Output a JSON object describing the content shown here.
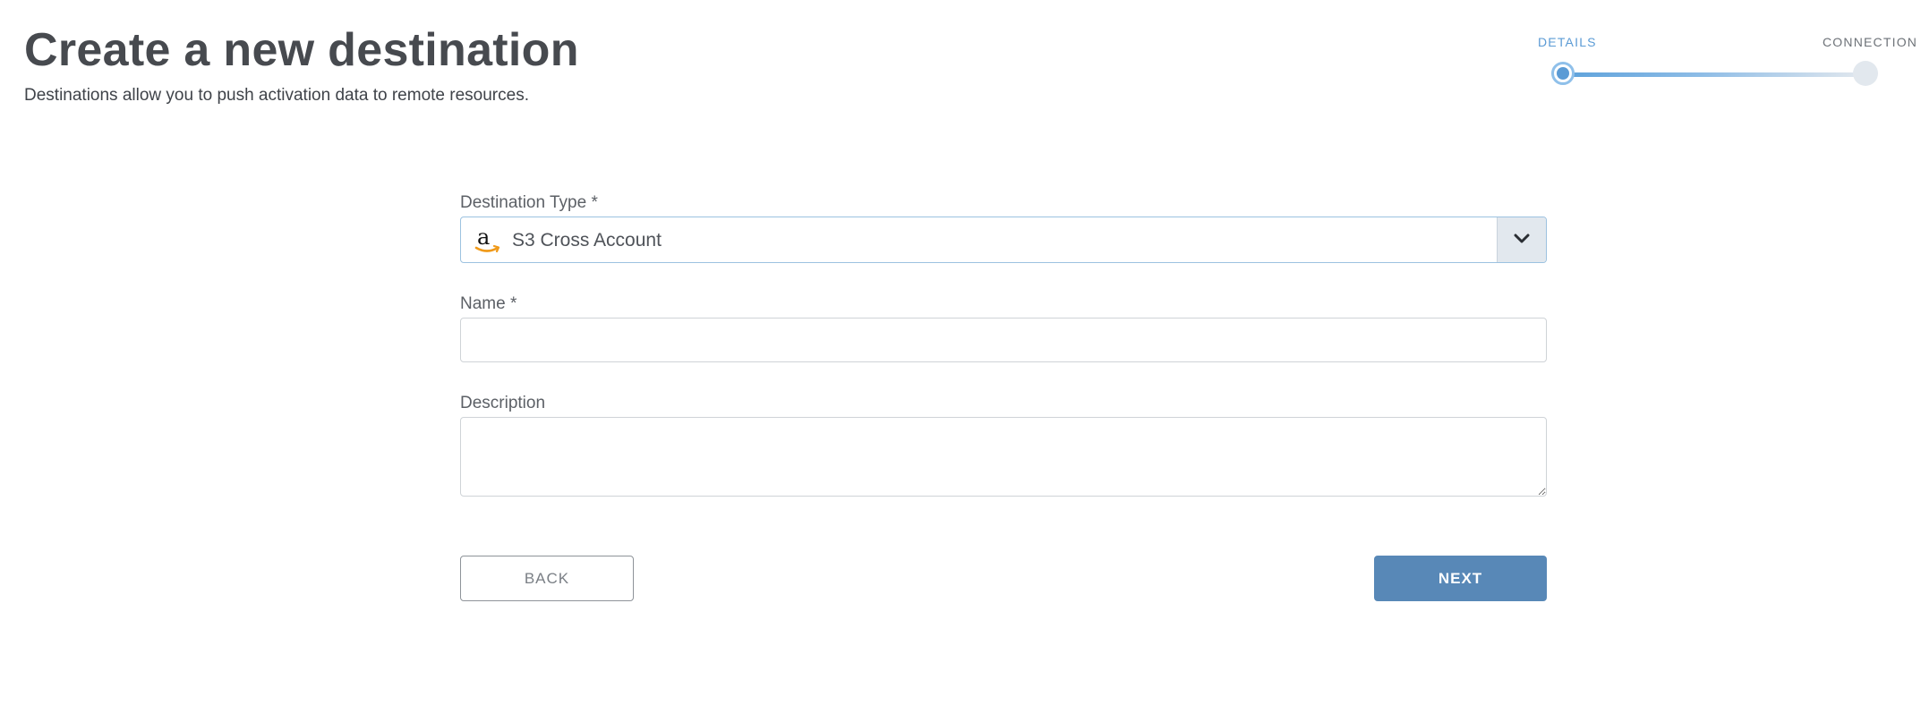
{
  "header": {
    "title": "Create a new destination",
    "subtitle": "Destinations allow you to push activation data to remote resources."
  },
  "stepper": {
    "steps": [
      {
        "label": "DETAILS",
        "state": "active"
      },
      {
        "label": "CONNECTION",
        "state": "inactive"
      }
    ],
    "accent_color": "#5b9bd5"
  },
  "form": {
    "destination_type": {
      "label": "Destination Type *",
      "value": "S3 Cross Account",
      "icon": "amazon-logo-icon",
      "toggle_icon": "chevron-down-icon"
    },
    "name": {
      "label": "Name *",
      "value": "",
      "placeholder": ""
    },
    "description": {
      "label": "Description",
      "value": "",
      "placeholder": ""
    }
  },
  "actions": {
    "back_label": "BACK",
    "next_label": "NEXT",
    "next_color": "#5888b7"
  }
}
